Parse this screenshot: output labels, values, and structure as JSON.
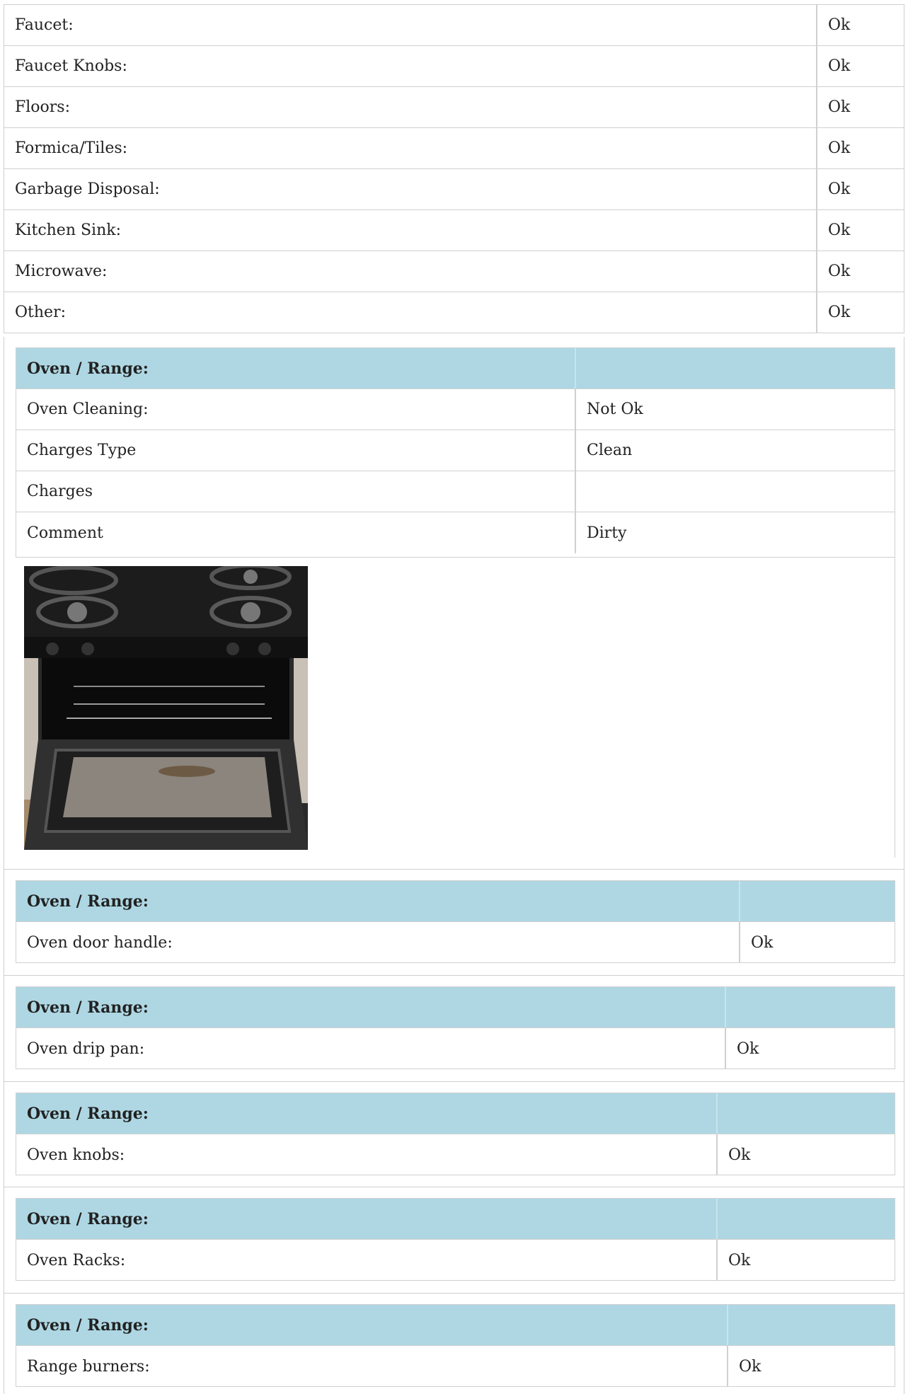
{
  "top_rows": [
    {
      "label": "Faucet:",
      "value": "Ok"
    },
    {
      "label": "Faucet Knobs:",
      "value": "Ok"
    },
    {
      "label": "Floors:",
      "value": "Ok"
    },
    {
      "label": "Formica/Tiles:",
      "value": "Ok"
    },
    {
      "label": "Garbage Disposal:",
      "value": "Ok"
    },
    {
      "label": "Kitchen Sink:",
      "value": "Ok"
    },
    {
      "label": "Microwave:",
      "value": "Ok"
    },
    {
      "label": "Other:",
      "value": "Ok"
    }
  ],
  "oven_main": {
    "header": "Oven / Range:",
    "rows": [
      {
        "label": "Oven Cleaning:",
        "value": "Not Ok"
      },
      {
        "label": "Charges Type",
        "value": "Clean"
      },
      {
        "label": "Charges",
        "value": ""
      },
      {
        "label": "Comment",
        "value": "Dirty"
      }
    ]
  },
  "oven_sections": [
    {
      "header": "Oven / Range:",
      "label": "Oven door handle:",
      "value": "Ok"
    },
    {
      "header": "Oven / Range:",
      "label": "Oven drip pan:",
      "value": "Ok"
    },
    {
      "header": "Oven / Range:",
      "label": "Oven knobs:",
      "value": "Ok"
    },
    {
      "header": "Oven / Range:",
      "label": "Oven Racks:",
      "value": "Ok"
    },
    {
      "header": "Oven / Range:",
      "label": "Range burners:",
      "value": "Ok"
    }
  ]
}
